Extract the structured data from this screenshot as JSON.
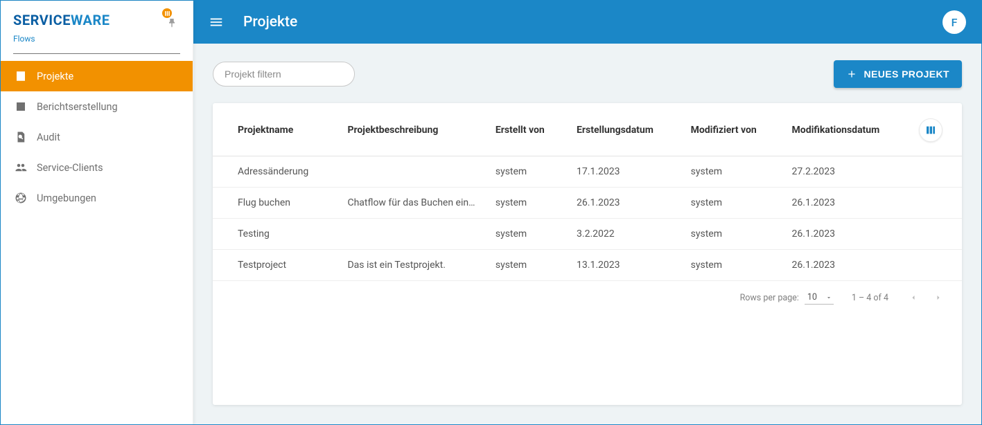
{
  "brand": {
    "part1": "SERVICE",
    "part2": "WARE",
    "subtitle": "Flows"
  },
  "sidebar": {
    "items": [
      {
        "label": "Projekte"
      },
      {
        "label": "Berichtserstellung"
      },
      {
        "label": "Audit"
      },
      {
        "label": "Service-Clients"
      },
      {
        "label": "Umgebungen"
      }
    ]
  },
  "header": {
    "title": "Projekte",
    "avatar_initial": "F"
  },
  "toolbar": {
    "filter_placeholder": "Projekt filtern",
    "new_project_label": "NEUES PROJEKT"
  },
  "table": {
    "columns": {
      "name": "Projektname",
      "desc": "Projektbeschreibung",
      "created_by": "Erstellt von",
      "created_at": "Erstellungsdatum",
      "modified_by": "Modifiziert von",
      "modified_at": "Modifikationsdatum"
    },
    "rows": [
      {
        "name": "Adressänderung",
        "desc": "",
        "created_by": "system",
        "created_at": "17.1.2023",
        "modified_by": "system",
        "modified_at": "27.2.2023"
      },
      {
        "name": "Flug buchen",
        "desc": "Chatflow für das Buchen ein...",
        "created_by": "system",
        "created_at": "26.1.2023",
        "modified_by": "system",
        "modified_at": "26.1.2023"
      },
      {
        "name": "Testing",
        "desc": "",
        "created_by": "system",
        "created_at": "3.2.2022",
        "modified_by": "system",
        "modified_at": "26.1.2023"
      },
      {
        "name": "Testproject",
        "desc": "Das ist ein Testprojekt.",
        "created_by": "system",
        "created_at": "13.1.2023",
        "modified_by": "system",
        "modified_at": "26.1.2023"
      }
    ]
  },
  "pagination": {
    "rows_per_page_label": "Rows per page:",
    "rows_per_page_value": "10",
    "range_text": "1 – 4 of 4"
  }
}
